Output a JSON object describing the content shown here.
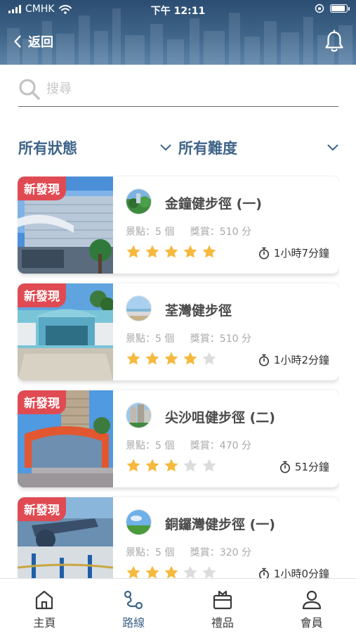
{
  "status_bar": {
    "carrier": "CMHK",
    "time": "下午 12:11"
  },
  "header": {
    "back_label": "返回"
  },
  "search": {
    "placeholder": "搜尋"
  },
  "filters": {
    "status_label": "所有狀態",
    "difficulty_label": "所有難度"
  },
  "routes": [
    {
      "badge": "新發現",
      "name": "金鐘健步徑 (一)",
      "spots": "景點：5 個",
      "reward": "獎賞：510 分",
      "rating": 5,
      "duration": "1小時7分鐘"
    },
    {
      "badge": "新發現",
      "name": "荃灣健步徑",
      "spots": "景點：5 個",
      "reward": "獎賞：510 分",
      "rating": 4,
      "duration": "1小時2分鐘"
    },
    {
      "badge": "新發現",
      "name": "尖沙咀健步徑 (二)",
      "spots": "景點：5 個",
      "reward": "獎賞：470 分",
      "rating": 3,
      "duration": "51分鐘"
    },
    {
      "badge": "新發現",
      "name": "銅鑼灣健步徑 (一)",
      "spots": "景點：5 個",
      "reward": "獎賞：320 分",
      "rating": 3,
      "duration": "1小時0分鐘"
    }
  ],
  "tabbar": {
    "tabs": [
      {
        "label": "主頁",
        "icon": "home-icon"
      },
      {
        "label": "路線",
        "icon": "route-icon"
      },
      {
        "label": "禮品",
        "icon": "gift-icon"
      },
      {
        "label": "會員",
        "icon": "member-icon"
      }
    ],
    "active": "路線"
  },
  "colors": {
    "brand": "#3f6589",
    "badge": "#e04b53",
    "star_on": "#f5b93d",
    "star_off": "#dcdcdc"
  },
  "max_rating": 5
}
